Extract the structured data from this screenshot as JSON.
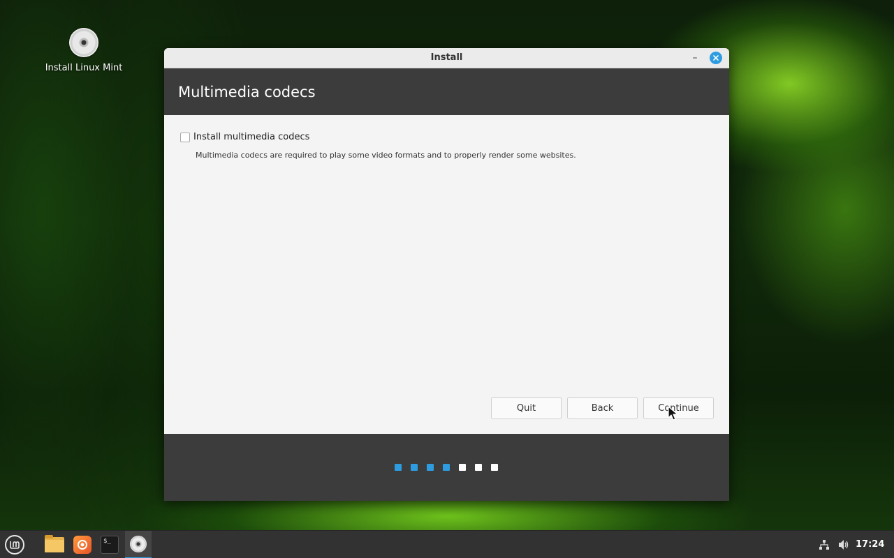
{
  "desktop": {
    "icon_label": "Install Linux Mint"
  },
  "window": {
    "title": "Install",
    "header_title": "Multimedia codecs",
    "checkbox_label": "Install multimedia codecs",
    "checkbox_checked": false,
    "description": "Multimedia codecs are required to play some video formats and to properly render some websites.",
    "buttons": {
      "quit": "Quit",
      "back": "Back",
      "continue": "Continue"
    },
    "progress": {
      "total_steps": 7,
      "completed_steps": 4,
      "active_color": "#2d9ce0",
      "inactive_color": "#ffffff"
    }
  },
  "taskbar": {
    "clock": "17:24",
    "apps": [
      "menu-icon",
      "folder-icon",
      "firefox-icon",
      "terminal-icon",
      "installer-disc-icon"
    ],
    "terminal_glyph": "$_"
  },
  "colors": {
    "accent": "#2d9ce0",
    "header_bg": "#3c3c3c",
    "taskbar_bg": "#323232"
  }
}
